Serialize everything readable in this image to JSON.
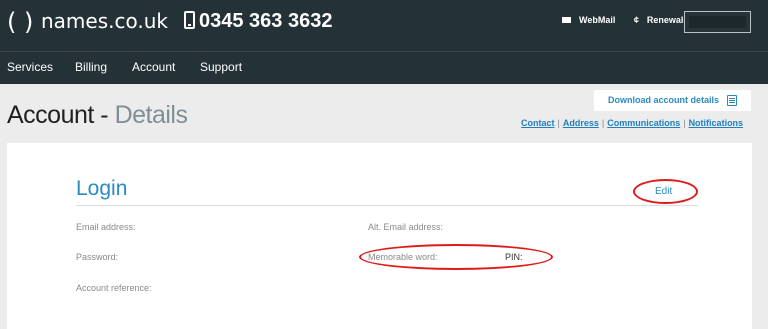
{
  "header": {
    "logo_paren": "( )",
    "logo_text": "names.co.uk",
    "phone": "0345 363 3632",
    "webmail": "WebMail",
    "renewals": "Renewals"
  },
  "nav": [
    "Services",
    "Billing",
    "Account",
    "Support"
  ],
  "page": {
    "title": "Account -",
    "title_light": "Details",
    "download_label": "Download account details",
    "sublinks": [
      "Contact",
      "Address",
      "Communications",
      "Notifications"
    ]
  },
  "login": {
    "title": "Login",
    "edit": "Edit",
    "email_label": "Email address:",
    "alt_email_label": "Alt. Email address:",
    "password_label": "Password:",
    "memorable_label": "Memorable word:",
    "pin_label": "PIN:",
    "account_ref_label": "Account reference:"
  },
  "icons": [
    "mail-icon",
    "renew-icon",
    "phone-icon",
    "document-icon"
  ],
  "colors": {
    "header_bg": "#243238",
    "accent": "#2a8bbf",
    "annotation_red": "#e01a1a"
  }
}
